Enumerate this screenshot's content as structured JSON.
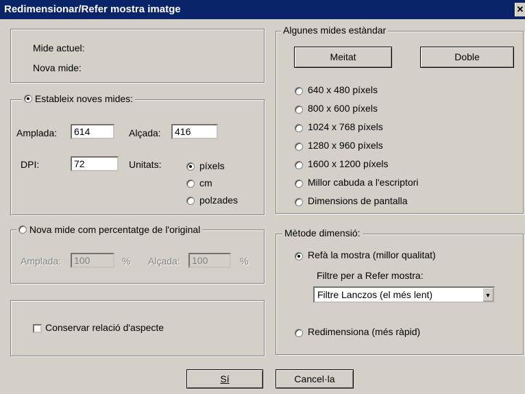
{
  "window": {
    "title": "Redimensionar/Refer mostra imatge",
    "close_glyph": "✕"
  },
  "current_size": {
    "current_label": "Mide actuel:",
    "new_label": "Nova mide:"
  },
  "set_new_sizes": {
    "option_label": "Estableix noves mides:",
    "width_label": "Amplada:",
    "width_value": "614",
    "height_label": "Alçada:",
    "height_value": "416",
    "dpi_label": "DPI:",
    "dpi_value": "72",
    "units_label": "Unitats:",
    "units": [
      {
        "label": "píxels",
        "selected": true
      },
      {
        "label": "cm",
        "selected": false
      },
      {
        "label": "polzades",
        "selected": false
      }
    ]
  },
  "percentage": {
    "option_label": "Nova mide com percentatge de l'original",
    "width_label": "Amplada:",
    "width_value": "100",
    "height_label": "Alçada:",
    "height_value": "100",
    "percent_sign": "%"
  },
  "aspect": {
    "label": "Conservar relació d'aspecte",
    "checked": false
  },
  "standard_sizes": {
    "legend": "Algunes mides estàndar",
    "half_button": "Meitat",
    "double_button": "Doble",
    "options": [
      "640 x 480 píxels",
      "800 x 600 píxels",
      "1024 x 768 píxels",
      "1280 x 960 píxels",
      "1600 x 1200 píxels",
      "Millor cabuda a l'escriptori",
      "Dimensions de pantalla"
    ]
  },
  "method": {
    "legend": "Mètode dimensió:",
    "resample_label": "Refà la mostra (millor qualitat)",
    "filter_label": "Filtre per a Refer mostra:",
    "filter_value": "Filtre Lanczos (el més lent)",
    "resize_label": "Redimensiona (més ràpid)",
    "selected": "resample"
  },
  "buttons": {
    "ok": "Sí",
    "cancel": "Cancel·la"
  },
  "colors": {
    "titlebar": "#0a246a",
    "face": "#d4d0c8"
  }
}
